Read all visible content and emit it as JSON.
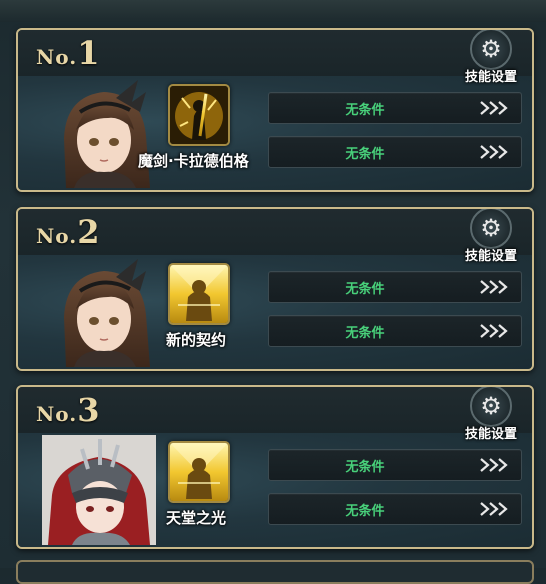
{
  "cards": [
    {
      "rank_prefix": "No.",
      "rank_num": "1",
      "settings_label": "技能设置",
      "skill_name": "魔剑·卡拉德伯格",
      "conditions": [
        "无条件",
        "无条件"
      ]
    },
    {
      "rank_prefix": "No.",
      "rank_num": "2",
      "settings_label": "技能设置",
      "skill_name": "新的契约",
      "conditions": [
        "无条件",
        "无条件"
      ]
    },
    {
      "rank_prefix": "No.",
      "rank_num": "3",
      "settings_label": "技能设置",
      "skill_name": "天堂之光",
      "conditions": [
        "无条件",
        "无条件"
      ]
    }
  ],
  "icons": {
    "settings": "gear-icon",
    "arrow": "triple-chevron-right-icon"
  },
  "colors": {
    "condition_text": "#48d07a",
    "frame": "#c9b98a",
    "rank": "#e8d7a7"
  }
}
